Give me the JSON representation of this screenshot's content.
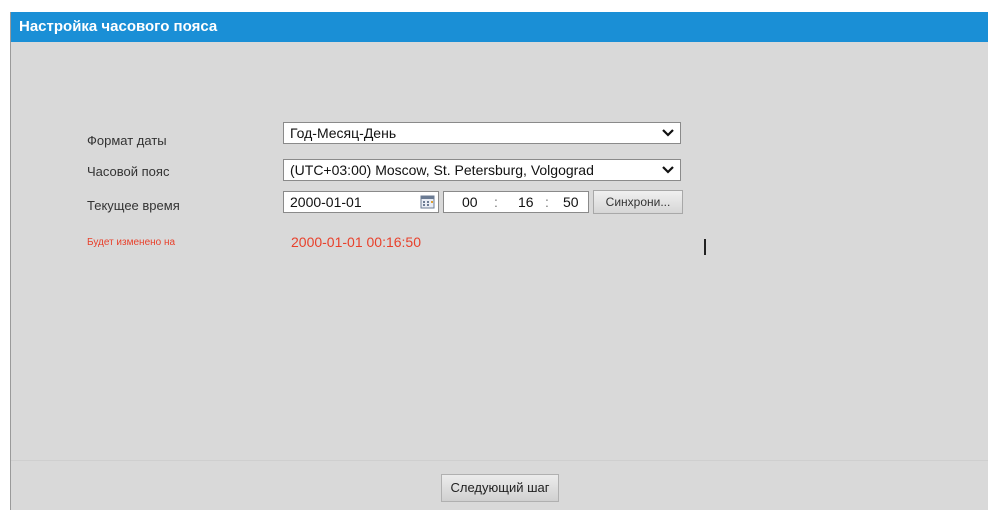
{
  "title": "Настройка часового пояса",
  "form": {
    "date_format_label": "Формат даты",
    "date_format_value": "Год-Месяц-День",
    "timezone_label": "Часовой пояс",
    "timezone_value": "(UTC+03:00) Moscow, St. Petersburg, Volgograd",
    "current_time_label": "Текущее время",
    "date_value": "2000-01-01",
    "time_hours": "00",
    "time_minutes": "16",
    "time_seconds": "50",
    "time_separator": ":",
    "sync_button": "Синхрони..."
  },
  "preview": {
    "label": "Будет изменено на",
    "value": "2000-01-01 00:16:50"
  },
  "footer": {
    "next_button": "Следующий шаг"
  },
  "colors": {
    "title_bar": "#1a8fd6",
    "background": "#d9d9d9",
    "warning_text": "#e8412c"
  }
}
